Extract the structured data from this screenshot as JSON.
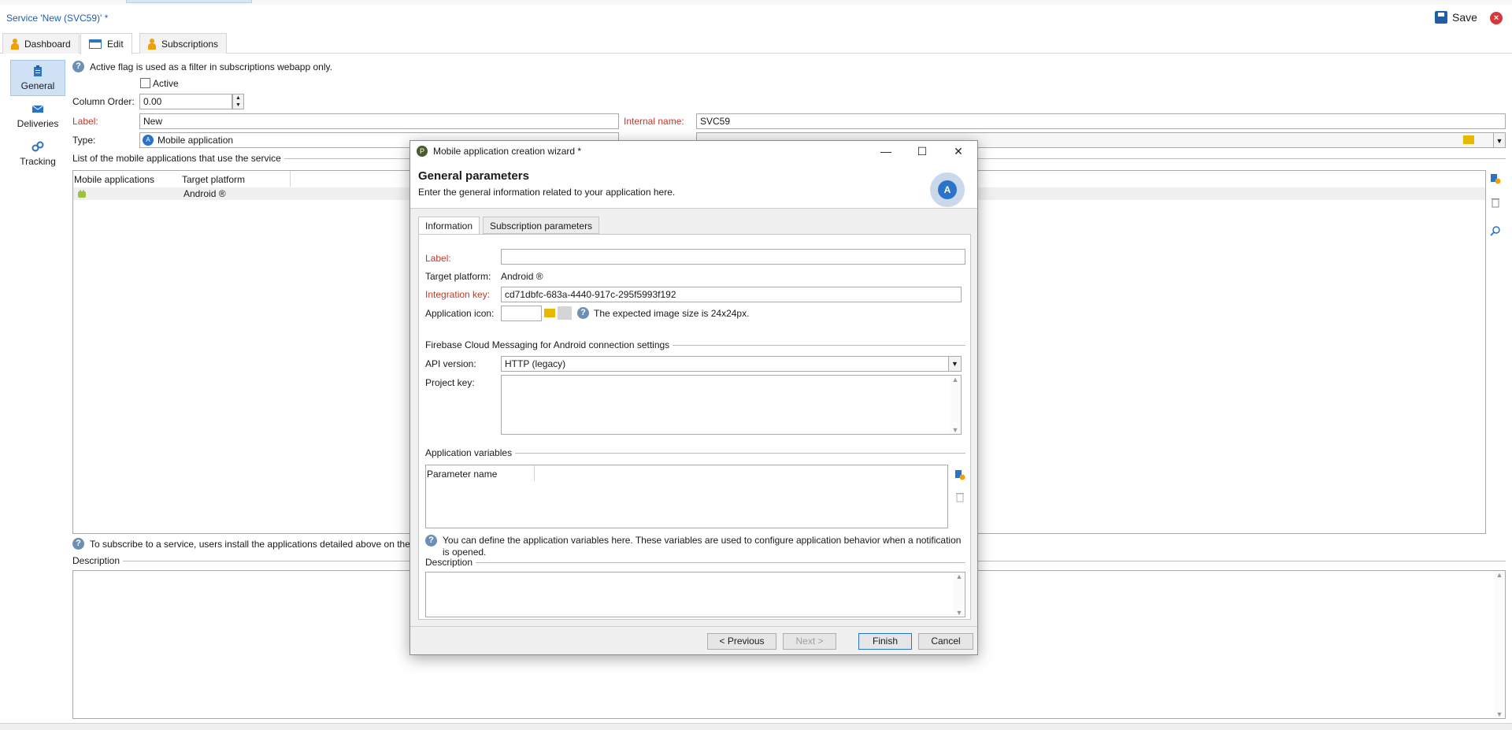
{
  "window": {
    "title": "Service 'New (SVC59)' *",
    "save_label": "Save"
  },
  "tabs": [
    {
      "label": "Dashboard"
    },
    {
      "label": "Edit"
    },
    {
      "label": "Subscriptions"
    }
  ],
  "sidebar": {
    "items": [
      {
        "label": "General",
        "icon": "clipboard-icon"
      },
      {
        "label": "Deliveries",
        "icon": "envelope-icon"
      },
      {
        "label": "Tracking",
        "icon": "link-icon"
      }
    ]
  },
  "form": {
    "active_note": "Active flag is used as a filter in subscriptions webapp only.",
    "active_label": "Active",
    "column_order_label": "Column Order:",
    "column_order_value": "0.00",
    "label_label": "Label:",
    "label_value": "New",
    "internal_name_label": "Internal name:",
    "internal_name_value": "SVC59",
    "type_label": "Type:",
    "type_value": "Mobile application",
    "mobile_apps_section": "List of the mobile applications that use the service",
    "grid_headers": [
      "Mobile applications",
      "Target platform"
    ],
    "grid_row_platform": "Android ®",
    "subscribe_note": "To subscribe to a service, users install the applications detailed above on their",
    "description_label": "Description"
  },
  "dialog": {
    "title": "Mobile application creation wizard *",
    "heading": "General parameters",
    "subheading": "Enter the general information related to your application here.",
    "tabs": [
      "Information",
      "Subscription parameters"
    ],
    "label_label": "Label:",
    "label_value": "",
    "target_platform_label": "Target platform:",
    "target_platform_value": "Android ®",
    "integration_key_label": "Integration key:",
    "integration_key_value": "cd71dbfc-683a-4440-917c-295f5993f192",
    "app_icon_label": "Application icon:",
    "app_icon_note": "The expected image size is 24x24px.",
    "fcm_section": "Firebase Cloud Messaging for Android connection settings",
    "api_version_label": "API version:",
    "api_version_value": "HTTP (legacy)",
    "project_key_label": "Project key:",
    "app_vars_section": "Application variables",
    "app_vars_header": "Parameter name",
    "app_vars_note": "You can define the application variables here. These variables are used to configure application behavior when a notification is opened.",
    "description_section": "Description",
    "buttons": {
      "previous": "< Previous",
      "next": "Next >",
      "finish": "Finish",
      "cancel": "Cancel"
    }
  },
  "colors": {
    "accent": "#1f5fa8",
    "required_label": "#c0392b",
    "selected_nav": "#cfe2f5"
  }
}
